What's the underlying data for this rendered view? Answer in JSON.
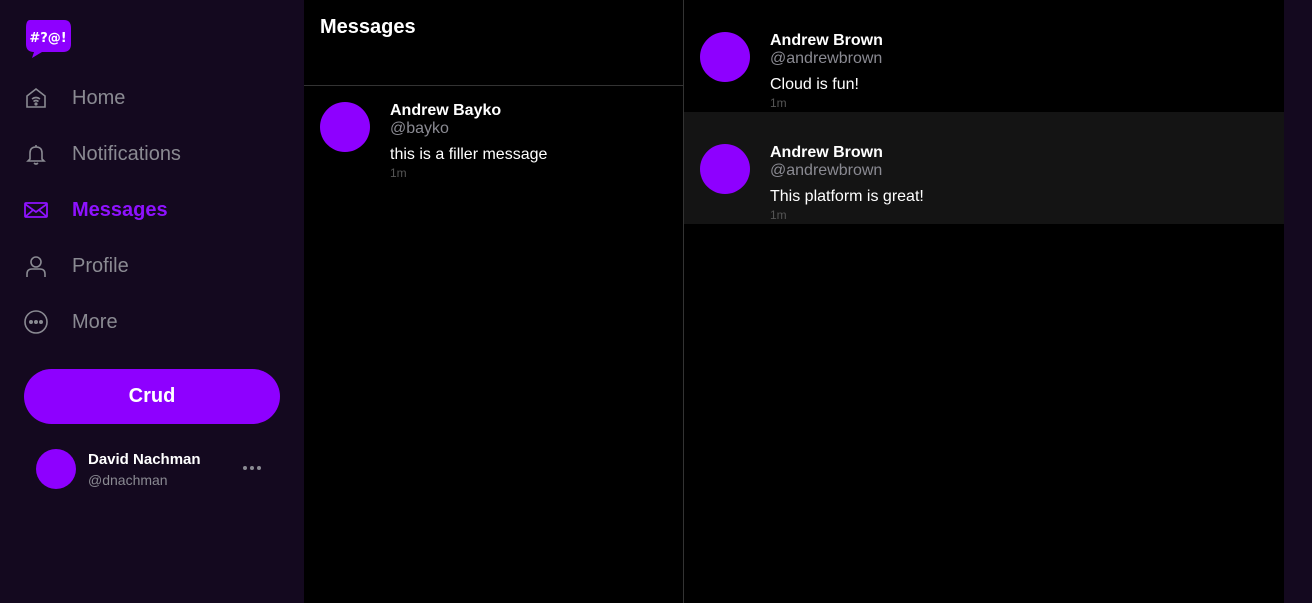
{
  "app": {
    "logo_text": "#?@!",
    "accent": "#8e00ff",
    "sidebar_bg": "#14091f"
  },
  "sidebar": {
    "items": [
      {
        "label": "Home",
        "icon": "home-icon",
        "active": false
      },
      {
        "label": "Notifications",
        "icon": "bell-icon",
        "active": false
      },
      {
        "label": "Messages",
        "icon": "envelope-icon",
        "active": true
      },
      {
        "label": "Profile",
        "icon": "person-icon",
        "active": false
      },
      {
        "label": "More",
        "icon": "ellipsis-circle-icon",
        "active": false
      }
    ],
    "crud_label": "Crud",
    "user": {
      "name": "David Nachman",
      "handle": "@dnachman"
    }
  },
  "messages": {
    "title": "Messages",
    "items": [
      {
        "name": "Andrew Bayko",
        "handle": "@bayko",
        "message": "this is a filler message",
        "time": "1m"
      }
    ]
  },
  "conversation": {
    "items": [
      {
        "name": "Andrew Brown",
        "handle": "@andrewbrown",
        "message": "Cloud is fun!",
        "time": "1m"
      },
      {
        "name": "Andrew Brown",
        "handle": "@andrewbrown",
        "message": "This platform is great!",
        "time": "1m"
      }
    ]
  }
}
